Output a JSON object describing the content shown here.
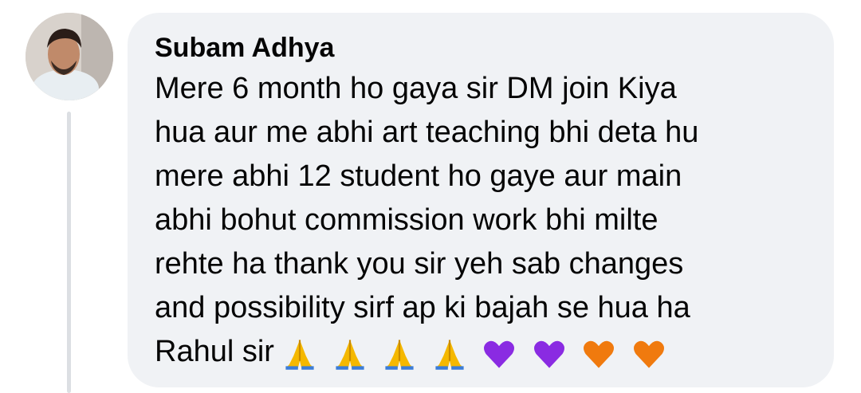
{
  "comment": {
    "author_name": "Subam Adhya",
    "lines": [
      "Mere 6 month ho gaya sir DM join Kiya",
      "hua aur me abhi art teaching bhi deta hu",
      "mere abhi 12 student ho gaye aur main",
      "abhi bohut commission work bhi milte",
      "rehte ha thank you sir yeh sab changes",
      "and possibility sirf ap ki bajah se hua ha",
      "Rahul sir"
    ],
    "emojis": [
      "folded-hands",
      "folded-hands",
      "folded-hands",
      "folded-hands",
      "purple-heart",
      "purple-heart",
      "orange-heart",
      "orange-heart"
    ]
  },
  "colors": {
    "bubble_background": "#f0f2f5",
    "text": "#050505",
    "thread_line": "#dcdfe3",
    "purple_heart": "#8a2be2",
    "orange_heart": "#f07a0e",
    "folded_hands": "#f5b800"
  }
}
